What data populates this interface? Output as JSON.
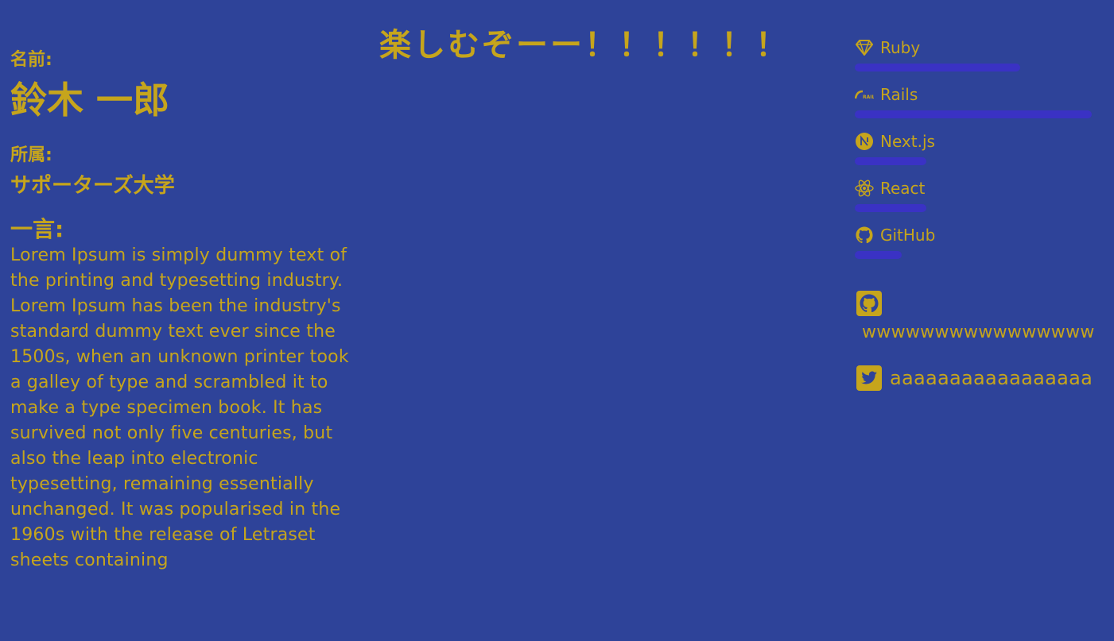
{
  "colors": {
    "background": "#2e4399",
    "text": "#c6a51c",
    "bar": "#3a32c4"
  },
  "profile": {
    "name_label": "名前:",
    "name": "鈴木 一郎",
    "affiliation_label": "所属:",
    "affiliation": "サポーターズ大学",
    "comment_label": "一言:",
    "comment": "Lorem Ipsum is simply dummy text of the printing and typesetting industry. Lorem Ipsum has been the industry's standard dummy text ever since the 1500s, when an unknown printer took a galley of type and scrambled it to make a type specimen book. It has survived not only five centuries, but also the leap into electronic typesetting, remaining essentially unchanged. It was popularised in the 1960s with the release of Letraset sheets containing"
  },
  "headline": "楽しむぞーー！！！！！！",
  "skills": [
    {
      "name": "Ruby",
      "icon": "ruby-icon",
      "level": 0.67
    },
    {
      "name": "Rails",
      "icon": "rails-icon",
      "level": 0.96
    },
    {
      "name": "Next.js",
      "icon": "nextjs-icon",
      "level": 0.29
    },
    {
      "name": "React",
      "icon": "react-icon",
      "level": 0.29
    },
    {
      "name": "GitHub",
      "icon": "github-icon",
      "level": 0.19
    }
  ],
  "social": {
    "github": {
      "icon": "github-square-icon",
      "handle": "wwwwwwwwwwwwwwww"
    },
    "twitter": {
      "icon": "twitter-square-icon",
      "handle": "aaaaaaaaaaaaaaaaa"
    }
  }
}
